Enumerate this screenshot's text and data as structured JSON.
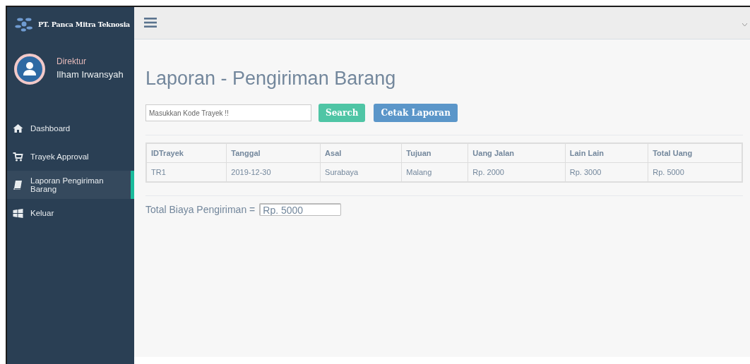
{
  "sidebar": {
    "brand": "PT. Panca Mitra Teknosia",
    "profile": {
      "role": "Direktur",
      "name": "Ilham Irwansyah"
    },
    "items": [
      {
        "label": "Dashboard",
        "kind": "home",
        "selected": false
      },
      {
        "label": "Trayek Approval",
        "kind": "cart",
        "selected": false
      },
      {
        "label": "Laporan Pengiriman Barang",
        "kind": "book",
        "selected": true
      },
      {
        "label": "Keluar",
        "kind": "windows",
        "selected": false
      }
    ]
  },
  "page": {
    "title": "Laporan - Pengiriman Barang",
    "search": {
      "placeholder": "Masukkan Kode Trayek !!"
    },
    "buttons": [
      {
        "label": "Search",
        "kind": "success"
      },
      {
        "label": "Cetak Laporan",
        "kind": "primary"
      }
    ],
    "table": {
      "columns": [
        "IDTrayek",
        "Tanggal",
        "Asal",
        "Tujuan",
        "Uang Jalan",
        "Lain Lain",
        "Total Uang"
      ],
      "rows": [
        [
          "TR1",
          "2019-12-30",
          "Surabaya",
          "Malang",
          "Rp. 2000",
          "Rp. 3000",
          "Rp. 5000"
        ]
      ]
    },
    "total": {
      "label": "Total Biaya Pengiriman =",
      "value": "Rp. 5000"
    }
  }
}
